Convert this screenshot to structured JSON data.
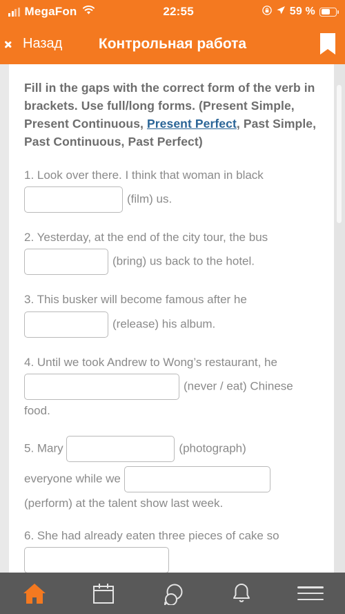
{
  "status_bar": {
    "carrier": "MegaFon",
    "time": "22:55",
    "battery_percent": "59 %",
    "signal_icon": "signal-bars-icon",
    "wifi_icon": "wifi-icon",
    "lock_icon": "rotation-lock-icon",
    "location_icon": "location-arrow-icon",
    "battery_icon": "battery-icon"
  },
  "header": {
    "back_label": "Назад",
    "title": "Контрольная работа",
    "back_icon": "chevron-left-icon",
    "bookmark_icon": "bookmark-icon"
  },
  "content": {
    "intro": {
      "part1": "Fill in the gaps with the correct form of the verb in brackets. Use full/long forms. (Present Simple, Present Continuous, ",
      "link": "Present Perfect",
      "part2": ", Past Simple, Past Continuous, Past Perfect)"
    },
    "questions": [
      {
        "number": "1.",
        "before": "1. Look over there. I think that woman in black",
        "after": "(film) us."
      },
      {
        "number": "2.",
        "before": "2. Yesterday, at the end of the city tour, the bus",
        "after": "(bring) us back to the hotel."
      },
      {
        "number": "3.",
        "before": "3. This busker will become famous after he",
        "after": "(release) his album."
      },
      {
        "number": "4.",
        "before": "4. Until we took Andrew to Wong’s restaurant, he",
        "after": "(never / eat) Chinese",
        "tail": "food."
      },
      {
        "number": "5.",
        "seg1": "5. Mary",
        "seg2": "(photograph)",
        "seg3": "everyone while we",
        "seg4": "(perform) at the talent show last week."
      },
      {
        "number": "6.",
        "before": "6. She had already eaten three pieces of cake so"
      }
    ]
  },
  "tabbar": {
    "items": [
      {
        "name": "home",
        "icon": "home-icon",
        "active": true
      },
      {
        "name": "calendar",
        "icon": "calendar-icon",
        "active": false
      },
      {
        "name": "messages",
        "icon": "chat-bubble-icon",
        "active": false
      },
      {
        "name": "notifications",
        "icon": "bell-icon",
        "active": false
      },
      {
        "name": "menu",
        "icon": "hamburger-menu-icon",
        "active": false
      }
    ]
  },
  "colors": {
    "accent": "#F47920",
    "tabbar_bg": "#595959",
    "text_gray": "#8a8a8a",
    "link": "#2a6496"
  },
  "scrollbar": {
    "visible": true
  }
}
